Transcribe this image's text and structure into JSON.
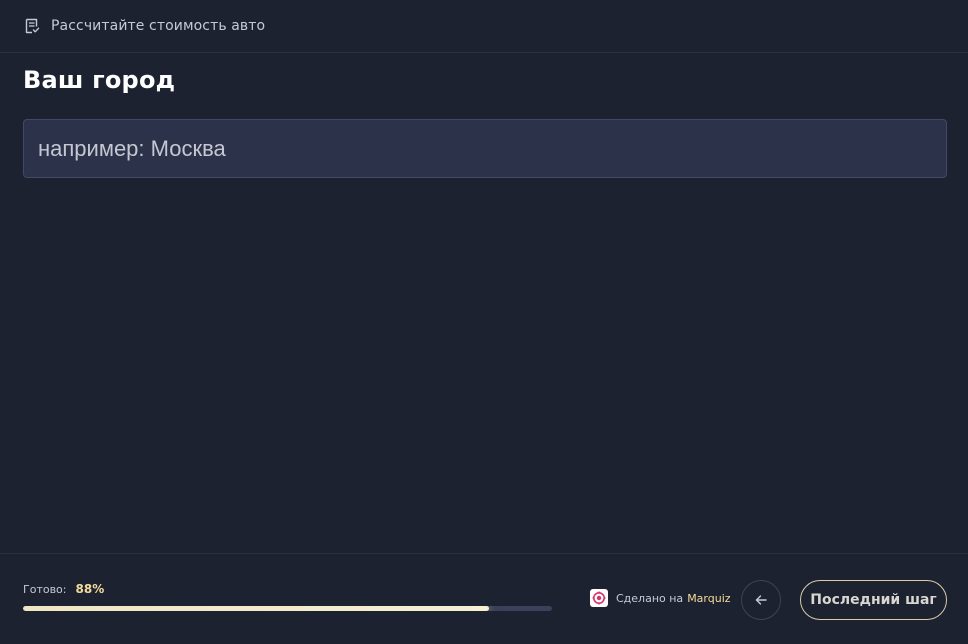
{
  "header": {
    "icon": "checklist-icon",
    "title": "Рассчитайте стоимость авто"
  },
  "question": {
    "title": "Ваш город",
    "input_placeholder": "например: Москва",
    "input_value": ""
  },
  "footer": {
    "progress_label": "Готово:",
    "progress_value": "88%",
    "progress_fraction": 0.88,
    "made_by_text": "Сделано на",
    "made_by_brand": "Marquiz",
    "back_icon": "arrow-left-icon",
    "next_label": "Последний шаг"
  },
  "colors": {
    "background": "#1d2231",
    "input_bg": "#2b3249",
    "accent": "#f3dc9b",
    "progress_fill": "#efe6c5",
    "brand_logo": "#d6336c"
  }
}
